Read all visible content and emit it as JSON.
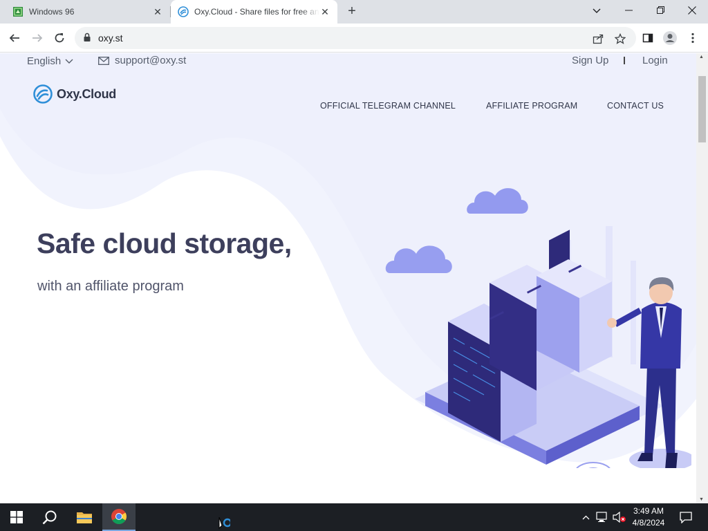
{
  "browser": {
    "tabs": [
      {
        "title": "Windows 96",
        "favicon": "windows96-icon",
        "active": false
      },
      {
        "title": "Oxy.Cloud - Share files for free and",
        "favicon": "oxycloud-icon",
        "active": true
      }
    ],
    "url": "oxy.st",
    "window_controls": [
      "tab-search",
      "minimize",
      "maximize",
      "close"
    ]
  },
  "site": {
    "language": "English",
    "support_email": "support@oxy.st",
    "signup": "Sign Up",
    "login": "Login",
    "logo": "Oxy.Cloud",
    "nav": [
      "OFFICIAL TELEGRAM CHANNEL",
      "AFFILIATE PROGRAM",
      "CONTACT US"
    ],
    "hero_title": "Safe cloud storage,",
    "hero_subtitle": "with an affiliate program",
    "colors": {
      "accent": "#2f8fd8",
      "text": "#3d3f5c",
      "illustration": "#8d8fe8",
      "bg_wave": "#f1f3fd"
    }
  },
  "taskbar": {
    "time": "3:49 AM",
    "date": "4/8/2024",
    "apps": [
      "start-icon",
      "search-icon",
      "file-explorer-icon",
      "chrome-icon"
    ]
  }
}
